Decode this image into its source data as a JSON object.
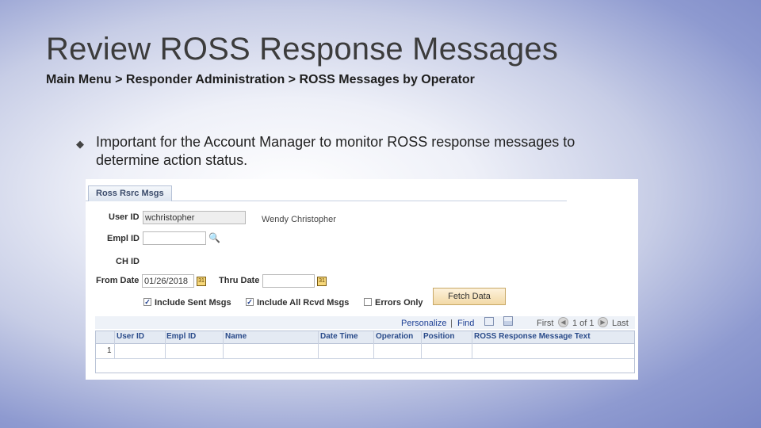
{
  "slide": {
    "title": "Review ROSS Response Messages",
    "breadcrumb": "Main Menu > Responder Administration > ROSS Messages by Operator",
    "bullet_icon": "diamond-bullet",
    "bullet_text": "Important for the Account Manager to monitor ROSS response messages to determine action status."
  },
  "app": {
    "tab_label": "Ross Rsrc Msgs",
    "form": {
      "user_id_label": "User ID",
      "user_id_value": "wchristopher",
      "user_name": "Wendy Christopher",
      "empl_id_label": "Empl ID",
      "empl_id_value": "",
      "ch_id_label": "CH ID",
      "from_date_label": "From Date",
      "from_date_value": "01/26/2018",
      "thru_date_label": "Thru Date",
      "thru_date_value": "",
      "include_sent_label": "Include Sent Msgs",
      "include_sent_checked": true,
      "include_recvd_label": "Include All Rcvd Msgs",
      "include_recvd_checked": true,
      "errors_only_label": "Errors Only",
      "errors_only_checked": false,
      "fetch_button": "Fetch Data"
    },
    "grid": {
      "personalize": "Personalize",
      "separator": "|",
      "find": "Find",
      "first": "First",
      "page_info": "1 of 1",
      "last": "Last",
      "columns": [
        "User ID",
        "Empl ID",
        "Name",
        "Date Time",
        "Operation",
        "Position",
        "ROSS Response Message Text"
      ],
      "rows": [
        {
          "num": "1"
        }
      ]
    }
  },
  "colors": {
    "link": "#1c3f94",
    "header_text": "#2a4b8a",
    "button_bg": "#f2d9a6"
  }
}
